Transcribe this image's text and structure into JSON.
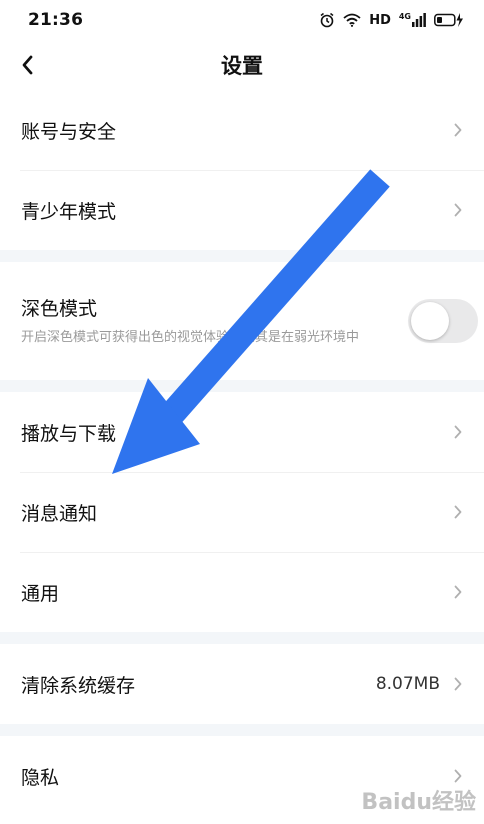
{
  "status_bar": {
    "time": "21:36",
    "hd": "HD",
    "net": "4G"
  },
  "header": {
    "title": "设置",
    "back_icon": "chevron-left-icon"
  },
  "groups": [
    {
      "items": [
        {
          "label": "账号与安全",
          "icon": "chevron-right-icon"
        },
        {
          "label": "青少年模式",
          "icon": "chevron-right-icon"
        }
      ]
    },
    {
      "items": [
        {
          "label": "深色模式",
          "description": "开启深色模式可获得出色的视觉体验，尤其是在弱光环境中",
          "toggle_on": false
        }
      ]
    },
    {
      "items": [
        {
          "label": "播放与下载",
          "icon": "chevron-right-icon"
        },
        {
          "label": "消息通知",
          "icon": "chevron-right-icon"
        },
        {
          "label": "通用",
          "icon": "chevron-right-icon"
        }
      ]
    },
    {
      "items": [
        {
          "label": "清除系统缓存",
          "value": "8.07MB",
          "icon": "chevron-right-icon"
        }
      ]
    },
    {
      "items": [
        {
          "label": "隐私",
          "icon": "chevron-right-icon"
        }
      ]
    }
  ],
  "colors": {
    "arrow": "#2f74ee",
    "group_gap": "#f3f6f9",
    "chevron": "#b0b0b0"
  },
  "watermark": "Baidu经验"
}
